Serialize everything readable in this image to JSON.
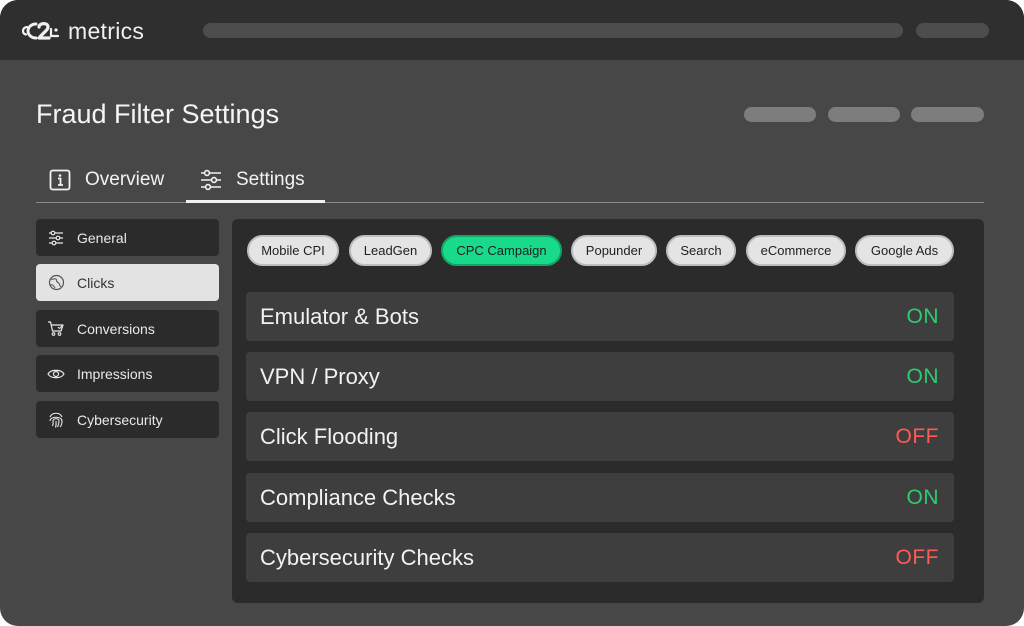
{
  "brand": {
    "logo_mark": "c2",
    "name": "metrics"
  },
  "page": {
    "title": "Fraud Filter Settings"
  },
  "tabs": [
    {
      "label": "Overview",
      "icon": "info-icon",
      "active": false
    },
    {
      "label": "Settings",
      "icon": "sliders-icon",
      "active": true
    }
  ],
  "sidebar": {
    "items": [
      {
        "label": "General",
        "icon": "sliders-icon",
        "active": false
      },
      {
        "label": "Clicks",
        "icon": "globe-icon",
        "active": true
      },
      {
        "label": "Conversions",
        "icon": "cart-icon",
        "active": false
      },
      {
        "label": "Impressions",
        "icon": "eye-icon",
        "active": false
      },
      {
        "label": "Cybersecurity",
        "icon": "fingerprint-icon",
        "active": false
      }
    ]
  },
  "campaign_types": [
    {
      "label": "Mobile CPI",
      "active": false
    },
    {
      "label": "LeadGen",
      "active": false
    },
    {
      "label": "CPC Campaign",
      "active": true
    },
    {
      "label": "Popunder",
      "active": false
    },
    {
      "label": "Search",
      "active": false
    },
    {
      "label": "eCommerce",
      "active": false
    },
    {
      "label": "Google Ads",
      "active": false
    }
  ],
  "filters": [
    {
      "label": "Emulator & Bots",
      "status": "ON"
    },
    {
      "label": "VPN / Proxy",
      "status": "ON"
    },
    {
      "label": "Click Flooding",
      "status": "OFF"
    },
    {
      "label": "Compliance Checks",
      "status": "ON"
    },
    {
      "label": "Cybersecurity Checks",
      "status": "OFF"
    }
  ],
  "colors": {
    "accent": "#19d98b",
    "status_on": "#2ecc71",
    "status_off": "#ff5a55"
  }
}
